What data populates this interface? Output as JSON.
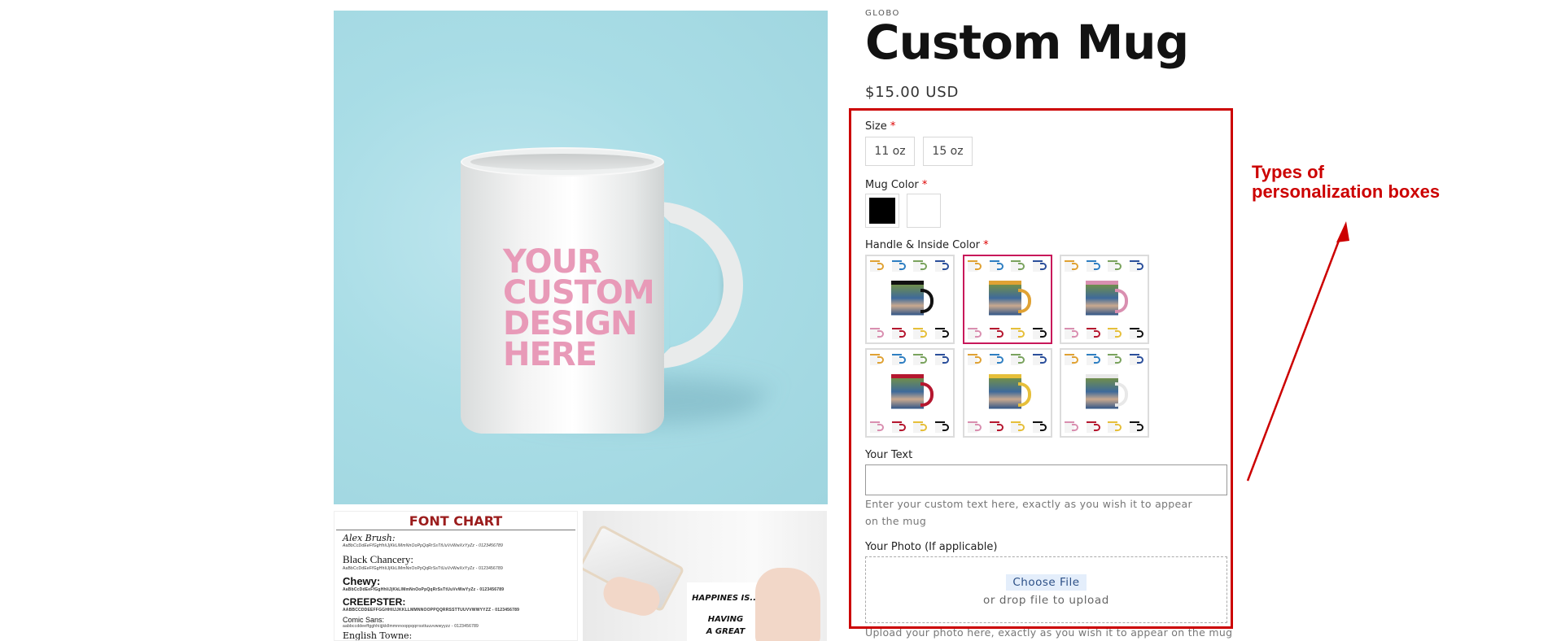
{
  "gallery": {
    "main_image": {
      "alt": "White mug on light blue background",
      "design_text": [
        "YOUR",
        "CUSTOM",
        "DESIGN",
        "HERE"
      ]
    },
    "font_chart": {
      "title": "FONT CHART",
      "fonts": [
        {
          "name": "Alex Brush:",
          "sample": "AaBbCcDdEeFfGgHhIiJjKkLlMmNnOoPpQqRrSsTtUuVvWwXxYyZz - 0123456789"
        },
        {
          "name": "Black Chancery:",
          "sample": "AaBbCcDdEeFfGgHhIiJjKkLlMmNnOoPpQqRrSsTtUuVvWwXxYyZz - 0123456789"
        },
        {
          "name": "Chewy:",
          "sample": "AaBbCcDdEeFfGgHhIiJjKkLlMmNnOoPpQqRrSsTtUuVvWwYyZz - 0123456789"
        },
        {
          "name": "CREEPSTER:",
          "sample": "AABBCCDDEEFFGGHHIIJJKKLLMMNNOOPPQQRRSSTTUUVVWWYYZZ - 0123456789"
        },
        {
          "name": "Comic Sans:",
          "sample": "aabbccddeeffgghhiijjkkllmmnnooppqqrrssttuuvvwwyyzz - 0123456789"
        },
        {
          "name": "English Towne:",
          "sample": ""
        }
      ]
    },
    "lifestyle_image": {
      "mug_text": [
        "HAPPINES IS...",
        "HAVING",
        "A GREAT"
      ]
    }
  },
  "product": {
    "vendor": "GLOBO",
    "title": "Custom Mug",
    "price": "$15.00 USD"
  },
  "options": {
    "required_marker": "*",
    "size": {
      "label": "Size",
      "values": [
        "11 oz",
        "15 oz"
      ]
    },
    "mug_color": {
      "label": "Mug Color",
      "swatches": [
        {
          "name": "Black",
          "color": "#000000"
        },
        {
          "name": "White",
          "color": "#ffffff"
        }
      ]
    },
    "handle_inside_color": {
      "label": "Handle & Inside Color",
      "selected_index": 1,
      "tiles": [
        {
          "name": "Black",
          "color": "#111111"
        },
        {
          "name": "Orange",
          "color": "#e0a234"
        },
        {
          "name": "Pink",
          "color": "#d98fb0"
        },
        {
          "name": "Red",
          "color": "#b5172f"
        },
        {
          "name": "Yellow",
          "color": "#e6bf3a"
        },
        {
          "name": "White",
          "color": "#e8e8e8"
        }
      ],
      "mini_top": [
        "#e0a234",
        "#2f7fc2",
        "#7aa35e",
        "#2b4f9b"
      ],
      "mini_bottom": [
        "#d98fb0",
        "#b5172f",
        "#e6bf3a",
        "#111111"
      ]
    },
    "your_text": {
      "label": "Your Text",
      "value": "",
      "placeholder": "",
      "help": "Enter your custom text here, exactly as you wish it to appear on the mug"
    },
    "your_photo": {
      "label": "Your Photo (If applicable)",
      "button": "Choose File",
      "drop_text": "or drop file to upload",
      "help": "Upload your photo here, exactly as you wish it to appear on the mug"
    }
  },
  "annotation": {
    "line1": "Types of",
    "line2": "personalization boxes",
    "color": "#cc0000"
  }
}
